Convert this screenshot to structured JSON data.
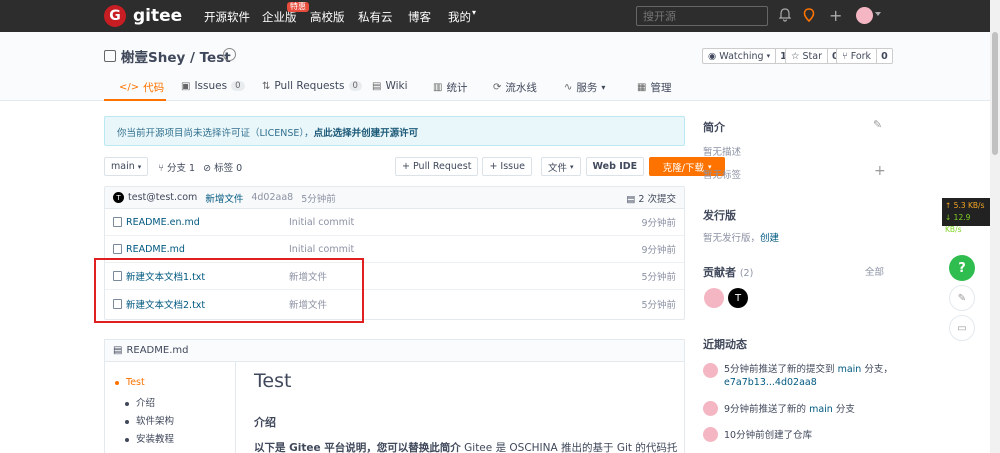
{
  "topnav": {
    "logo_letter": "G",
    "logo_text": "gitee",
    "links": [
      "开源软件",
      "企业版",
      "高校版",
      "私有云",
      "博客",
      "我的"
    ],
    "enterprise_badge": "特惠",
    "search_placeholder": "搜开源"
  },
  "repo": {
    "owner": "榭壹Shey",
    "name": "Test",
    "title": "榭壹Shey / Test",
    "watching_label": "Watching",
    "watching_count": "1",
    "star_label": "Star",
    "star_count": "0",
    "fork_label": "Fork",
    "fork_count": "0"
  },
  "tabs": [
    {
      "label": "代码",
      "icon": "</>",
      "active": true
    },
    {
      "label": "Issues",
      "count": "0"
    },
    {
      "label": "Pull Requests",
      "count": "0"
    },
    {
      "label": "Wiki"
    },
    {
      "label": "统计"
    },
    {
      "label": "流水线"
    },
    {
      "label": "服务"
    },
    {
      "label": "管理"
    }
  ],
  "notice": {
    "text": "你当前开源项目尚未选择许可证（LICENSE），",
    "link": "点此选择并创建开源许可"
  },
  "toolbar": {
    "branch": "main",
    "branches": "分支 1",
    "tags": "标签 0",
    "pull_request": "+ Pull Request",
    "issue": "+ Issue",
    "file": "文件",
    "web_ide": "Web IDE",
    "clone": "克隆/下载"
  },
  "commit": {
    "author": "test@test.com",
    "avatar_letter": "T",
    "message": "新增文件",
    "hash": "4d02aa8",
    "time": "5分钟前",
    "count": "2 次提交"
  },
  "files": [
    {
      "name": "README.en.md",
      "commit": "Initial commit",
      "time": "9分钟前"
    },
    {
      "name": "README.md",
      "commit": "Initial commit",
      "time": "9分钟前"
    },
    {
      "name": "新建文本文档1.txt",
      "commit": "新增文件",
      "time": "5分钟前"
    },
    {
      "name": "新建文本文档2.txt",
      "commit": "新增文件",
      "time": "5分钟前"
    }
  ],
  "readme": {
    "filename": "README.md",
    "toc": [
      "Test",
      "介绍",
      "软件架构",
      "安装教程"
    ],
    "h1": "Test",
    "h2": "介绍",
    "p_bold": "以下是 Gitee 平台说明，您可以替换此简介",
    "p_rest": " Gitee 是 OSCHINA 推出的基于 Git 的代码托"
  },
  "sidebar": {
    "intro_title": "简介",
    "no_desc": "暂无描述",
    "no_tags": "暂无标签",
    "release_title": "发行版",
    "no_release": "暂无发行版，",
    "create_link": "创建",
    "contrib_title": "贡献者",
    "contrib_count": "(2)",
    "all_link": "全部",
    "contrib_letter": "T",
    "activity_title": "近期动态",
    "activity": [
      {
        "text": "5分钟前推送了新的提交到",
        "link": "main",
        "tail": "分支，",
        "line2": "e7a7b13...4d02aa8"
      },
      {
        "text": "9分钟前推送了新的",
        "link": "main",
        "tail": "分支",
        "line2": ""
      },
      {
        "text": "10分钟前创建了仓库",
        "link": "",
        "tail": "",
        "line2": ""
      }
    ]
  },
  "netspeed": {
    "up": "↑ 5.3 KB/s",
    "down": "↓ 12.9 KB/s"
  },
  "help_label": "?"
}
